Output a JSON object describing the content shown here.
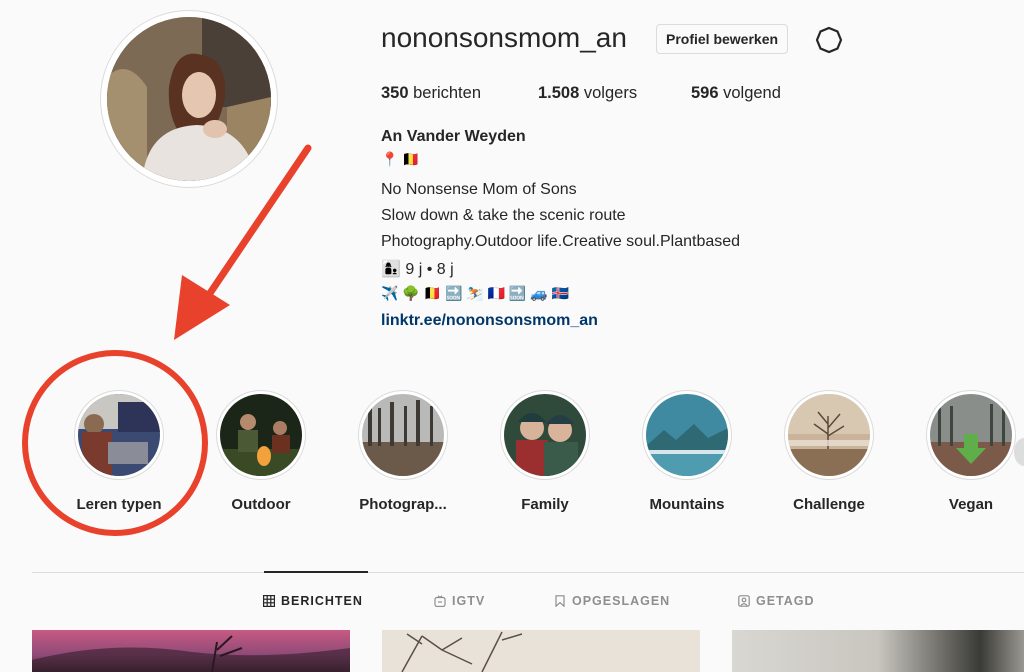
{
  "profile": {
    "username": "nononsonsmom_an",
    "edit_button": "Profiel bewerken",
    "settings_icon": "gear-icon"
  },
  "stats": {
    "posts_count": "350",
    "posts_label": " berichten",
    "followers_count": "1.508",
    "followers_label": " volgers",
    "following_count": "596",
    "following_label": " volgend"
  },
  "bio": {
    "name": "An Vander Weyden",
    "line_flags": "📍 🇧🇪",
    "line1": "No Nonsense Mom of Sons",
    "line2": "Slow down & take the scenic route",
    "line3": "Photography.Outdoor life.Creative soul.Plantbased",
    "line4": "👩‍👦 9 j • 8 j",
    "line5": "✈️ 🌳 🇧🇪 🔜 ⛷️ 🇫🇷 🔜 🚙 🇮🇸",
    "link": "linktr.ee/nononsonsmom_an"
  },
  "highlights": [
    {
      "label": "Leren typen"
    },
    {
      "label": "Outdoor"
    },
    {
      "label": "Photograp..."
    },
    {
      "label": "Family"
    },
    {
      "label": "Mountains"
    },
    {
      "label": "Challenge"
    },
    {
      "label": "Vegan"
    }
  ],
  "tabs": [
    {
      "label": "BERICHTEN",
      "icon": "grid-icon",
      "active": true
    },
    {
      "label": "IGTV",
      "icon": "igtv-icon",
      "active": false
    },
    {
      "label": "OPGESLAGEN",
      "icon": "bookmark-icon",
      "active": false
    },
    {
      "label": "GETAGD",
      "icon": "tagged-icon",
      "active": false
    }
  ],
  "colors": {
    "annotation": "#e8412c",
    "link": "#00376b",
    "text": "#262626",
    "border": "#dbdbdb"
  }
}
